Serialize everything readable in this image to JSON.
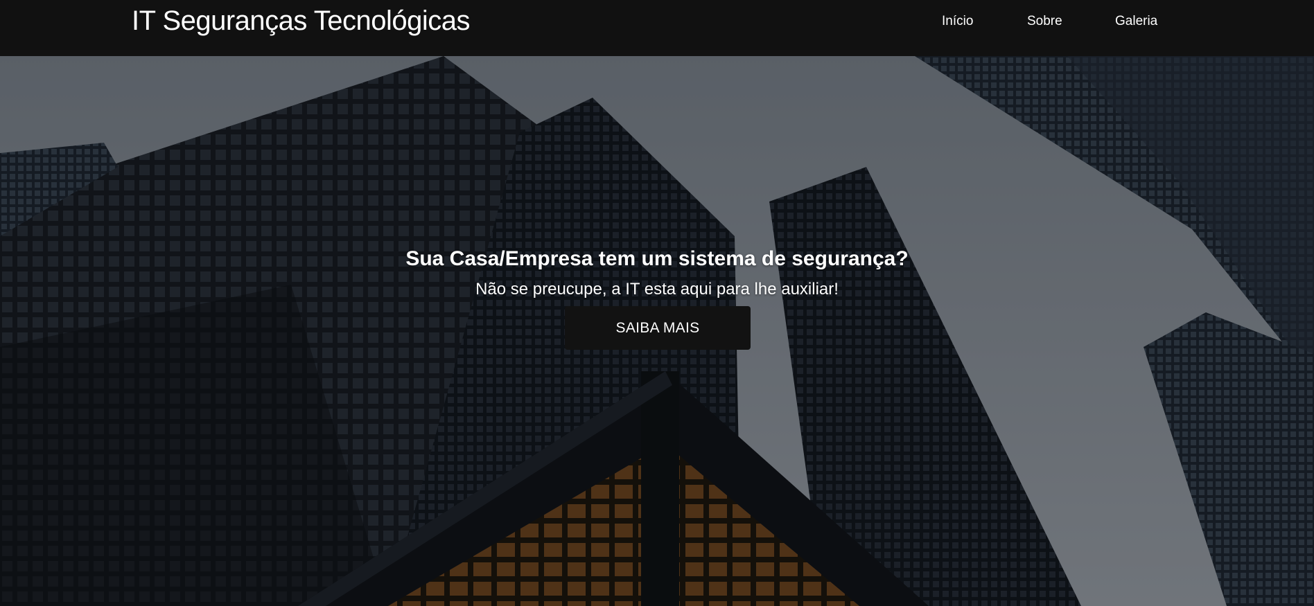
{
  "header": {
    "brand": "IT Seguranças Tecnológicas",
    "nav": [
      {
        "label": "Início"
      },
      {
        "label": "Sobre"
      },
      {
        "label": "Galeria"
      }
    ]
  },
  "hero": {
    "headline": "Sua Casa/Empresa tem um sistema de segurança?",
    "subheadline": "Não se preucupe, a IT esta aqui para lhe auxiliar!",
    "cta_label": "SAIBA MAIS",
    "background": "city-skyscrapers-photo"
  },
  "colors": {
    "header_bg": "#111111",
    "button_bg": "#121212",
    "text": "#ffffff"
  }
}
